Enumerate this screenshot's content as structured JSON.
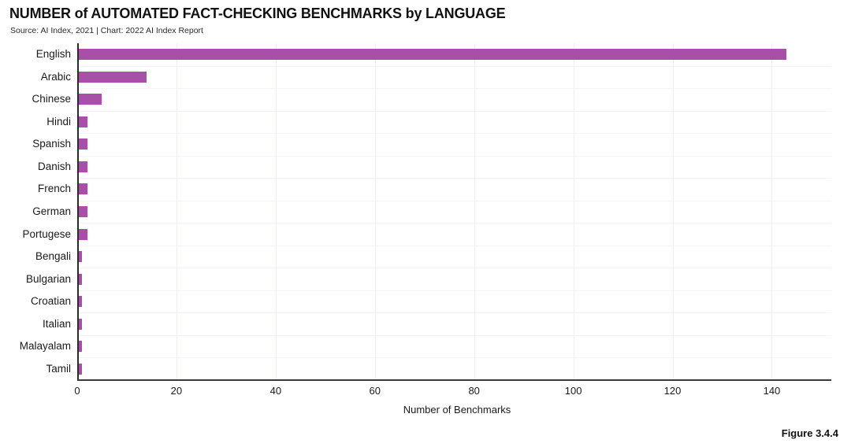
{
  "chart_data": {
    "type": "bar",
    "orientation": "horizontal",
    "title": "NUMBER of AUTOMATED FACT-CHECKING BENCHMARKS by LANGUAGE",
    "source": "Source: AI Index, 2021 | Chart: 2022 AI Index Report",
    "figure_label": "Figure 3.4.4",
    "xlabel": "Number of Benchmarks",
    "ylabel": "",
    "categories": [
      "English",
      "Arabic",
      "Chinese",
      "Hindi",
      "Spanish",
      "Danish",
      "French",
      "German",
      "Portugese",
      "Bengali",
      "Bulgarian",
      "Croatian",
      "Italian",
      "Malayalam",
      "Tamil"
    ],
    "values": [
      143,
      14,
      5,
      2,
      2,
      2,
      2,
      2,
      2,
      1,
      1,
      1,
      1,
      1,
      1
    ],
    "xlim": [
      0,
      152
    ],
    "xticks": [
      0,
      20,
      40,
      60,
      80,
      100,
      120,
      140
    ],
    "grid": "vertical",
    "legend": "none",
    "bar_color": "#a84fa8",
    "series": [
      {
        "name": "Number of Benchmarks",
        "values": [
          143,
          14,
          5,
          2,
          2,
          2,
          2,
          2,
          2,
          1,
          1,
          1,
          1,
          1,
          1
        ]
      }
    ]
  },
  "colors": {
    "bar": "#a84fa8",
    "axis": "#2b2b2b",
    "grid": "#f1eef3",
    "text": "#1a1a1a",
    "background": "#ffffff"
  }
}
